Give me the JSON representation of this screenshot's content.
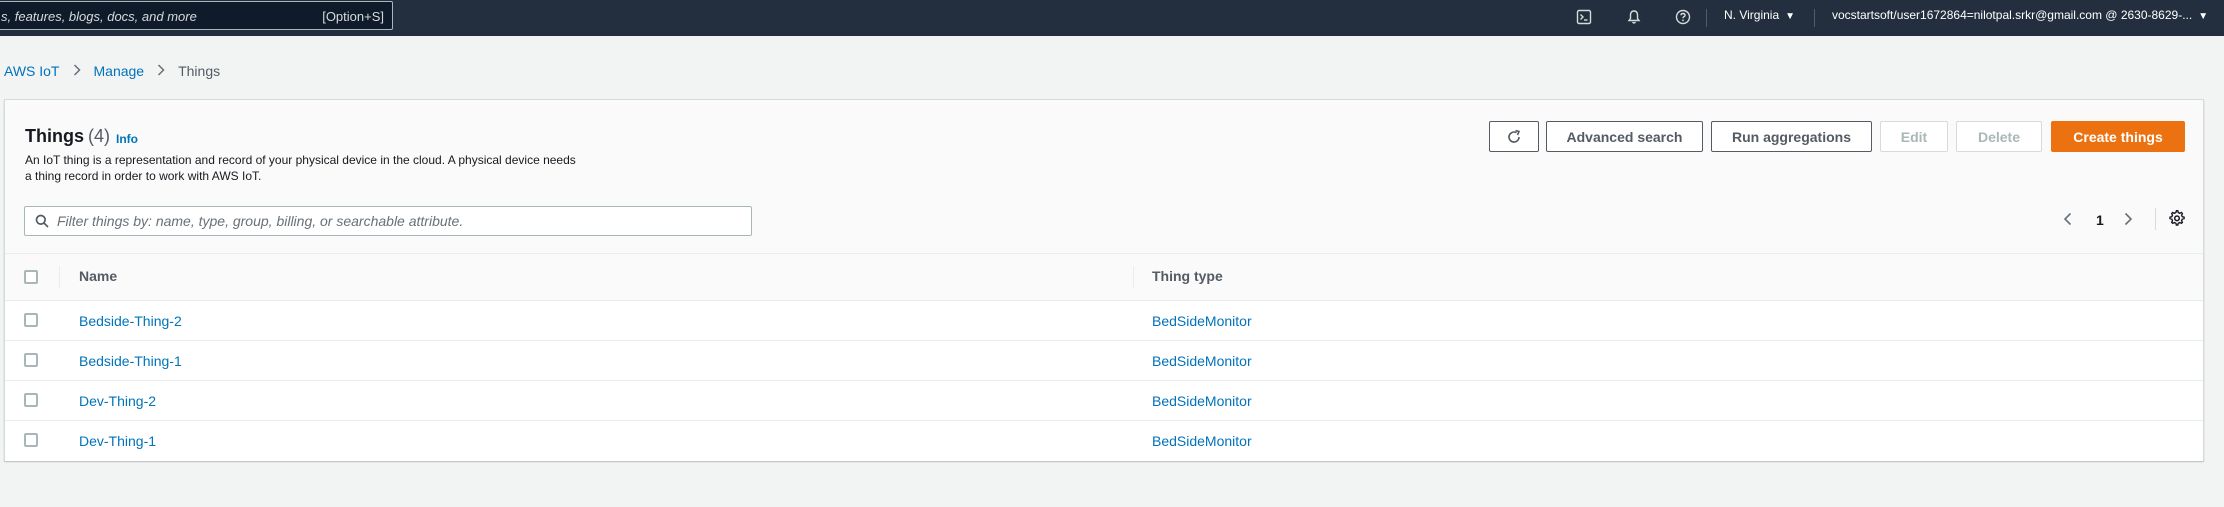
{
  "topbar": {
    "search_text": "s, features, blogs, docs, and more",
    "search_shortcut": "[Option+S]",
    "icons": [
      "cloudshell-icon",
      "bell-icon",
      "help-icon"
    ],
    "region": "N. Virginia",
    "account": "vocstartsoft/user1672864=nilotpal.srkr@gmail.com @ 2630-8629-..."
  },
  "breadcrumb": {
    "items": [
      "AWS IoT",
      "Manage",
      "Things"
    ]
  },
  "header": {
    "title": "Things",
    "count": "(4)",
    "info": "Info",
    "description": "An IoT thing is a representation and record of your physical device in the cloud. A physical device needs a thing record in order to work with AWS IoT."
  },
  "actions": {
    "advanced_search": "Advanced search",
    "run_aggregations": "Run aggregations",
    "edit": "Edit",
    "delete": "Delete",
    "create": "Create things"
  },
  "filter": {
    "value": "",
    "placeholder": "Filter things by: name, type, group, billing, or searchable attribute."
  },
  "pagination": {
    "current_page": "1"
  },
  "table": {
    "columns": [
      "Name",
      "Thing type"
    ],
    "rows": [
      {
        "name": "Bedside-Thing-2",
        "type": "BedSideMonitor"
      },
      {
        "name": "Bedside-Thing-1",
        "type": "BedSideMonitor"
      },
      {
        "name": "Dev-Thing-2",
        "type": "BedSideMonitor"
      },
      {
        "name": "Dev-Thing-1",
        "type": "BedSideMonitor"
      }
    ]
  },
  "colors": {
    "nav_bg": "#232f3e",
    "link": "#0073bb",
    "primary_button": "#ec7211",
    "page_bg": "#f2f3f3"
  }
}
